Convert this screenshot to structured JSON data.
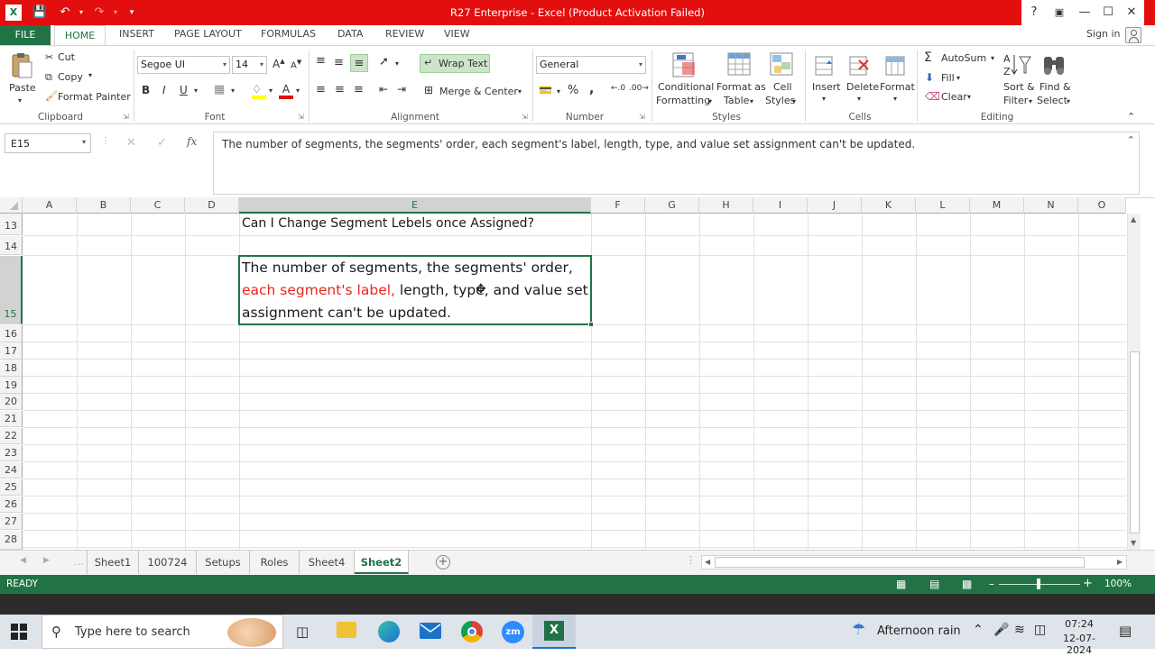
{
  "window": {
    "title": "R27 Enterprise - Excel (Product Activation Failed)",
    "help": "?",
    "sign_in": "Sign in"
  },
  "tabs": [
    "FILE",
    "HOME",
    "INSERT",
    "PAGE LAYOUT",
    "FORMULAS",
    "DATA",
    "REVIEW",
    "VIEW"
  ],
  "ribbon": {
    "clipboard": {
      "label": "Clipboard",
      "paste": "Paste",
      "cut": "Cut",
      "copy": "Copy",
      "format_painter": "Format Painter"
    },
    "font": {
      "label": "Font",
      "name": "Segoe UI",
      "size": "14",
      "bold": "B",
      "italic": "I",
      "underline": "U"
    },
    "alignment": {
      "label": "Alignment",
      "wrap_text": "Wrap Text",
      "merge_center": "Merge & Center"
    },
    "number": {
      "label": "Number",
      "format": "General",
      "percent": "%",
      "comma": ","
    },
    "styles": {
      "label": "Styles",
      "conditional": "Conditional",
      "formatting": "Formatting",
      "format_as": "Format as",
      "table": "Table",
      "cell": "Cell",
      "cell_styles": "Styles"
    },
    "cells": {
      "label": "Cells",
      "insert": "Insert",
      "delete": "Delete",
      "format": "Format"
    },
    "editing": {
      "label": "Editing",
      "autosum": "AutoSum",
      "fill": "Fill",
      "clear": "Clear",
      "sort": "Sort &",
      "filter": "Filter",
      "find": "Find &",
      "select": "Select"
    }
  },
  "formula_bar": {
    "name_box": "E15",
    "fx": "fx",
    "content": "The number of segments, the segments' order, each segment's label, length, type, and value set assignment can't be updated."
  },
  "columns": [
    "A",
    "B",
    "C",
    "D",
    "E",
    "F",
    "G",
    "H",
    "I",
    "J",
    "K",
    "L",
    "M",
    "N",
    "O"
  ],
  "rows": [
    "13",
    "14",
    "15",
    "16",
    "17",
    "18",
    "19",
    "20",
    "21",
    "22",
    "23",
    "24",
    "25",
    "26",
    "27",
    "28"
  ],
  "cells": {
    "e13": "Can I Change Segment Lebels once Assigned?",
    "e15_line1": "The number of segments, the segments' order,",
    "e15_line2_red": "each segment's label,",
    "e15_line2_rest": " length, type, and value set",
    "e15_line3": "assignment can't be updated."
  },
  "sheets": [
    "Sheet1",
    "100724",
    "Setups",
    "Roles",
    "Sheet4",
    "Sheet2"
  ],
  "active_sheet": "Sheet2",
  "status": {
    "ready": "READY",
    "zoom": "100%"
  },
  "taskbar": {
    "search": "Type here to search",
    "weather": "Afternoon rain",
    "time": "07:24",
    "date": "12-07-2024"
  },
  "colors": {
    "excel_green": "#217346",
    "title_red": "#e30e0e",
    "red_text": "#e8271c"
  }
}
